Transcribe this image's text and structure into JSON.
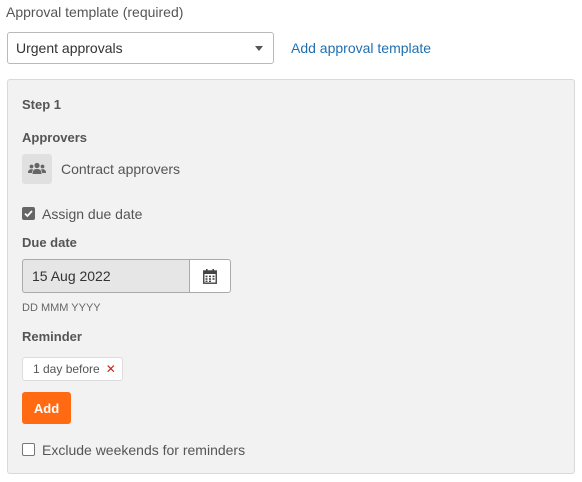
{
  "template": {
    "label": "Approval template (required)",
    "selected": "Urgent approvals",
    "add_link": "Add approval template"
  },
  "step": {
    "title": "Step 1",
    "approvers_label": "Approvers",
    "approver_name": "Contract approvers",
    "assign_due_date_label": "Assign due date",
    "assign_due_date_checked": true,
    "due_date_label": "Due date",
    "due_date_value": "15 Aug 2022",
    "due_date_format_hint": "DD MMM YYYY",
    "reminder_label": "Reminder",
    "reminders": [
      "1 day before"
    ],
    "add_button": "Add",
    "exclude_weekends_label": "Exclude weekends for reminders",
    "exclude_weekends_checked": false
  },
  "colors": {
    "link": "#1f6fb2",
    "primary_button": "#ff6a13",
    "remove_x": "#cc2222",
    "panel_bg": "#f2f2f2"
  },
  "icons": {
    "select_caret": "chevron-down-icon",
    "approver_group": "users-group-icon",
    "calendar": "calendar-icon",
    "remove": "close-icon"
  }
}
